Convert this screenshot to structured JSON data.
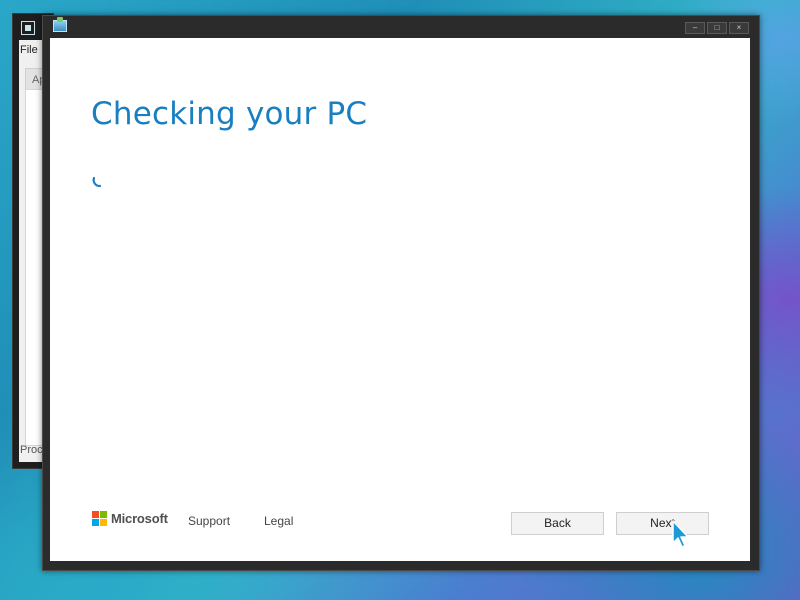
{
  "background_window": {
    "menu_label": "File",
    "tab_label": "Ap",
    "status_text": "Proc"
  },
  "window": {
    "controls": {
      "minimize": "–",
      "maximize": "□",
      "close": "×"
    }
  },
  "page": {
    "title": "Checking your PC",
    "spinner": "loading-spinner"
  },
  "footer": {
    "brand": "Microsoft",
    "links": [
      "Support",
      "Legal"
    ],
    "buttons": {
      "back": "Back",
      "next": "Next"
    }
  },
  "colors": {
    "title": "#1a7fc1",
    "ms_red": "#f25022",
    "ms_green": "#7fba00",
    "ms_blue": "#00a4ef",
    "ms_yellow": "#ffb900",
    "cursor": "#1f9ad8"
  }
}
